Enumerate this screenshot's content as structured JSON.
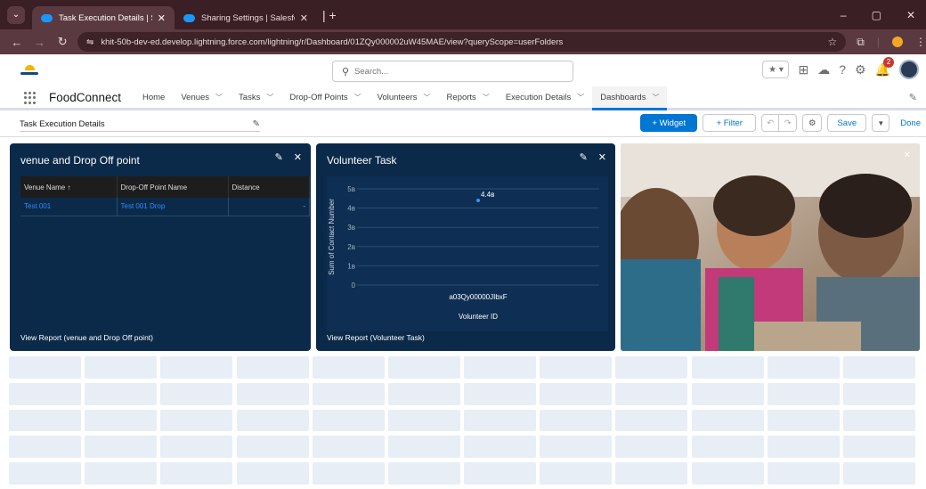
{
  "browser": {
    "tabs": [
      {
        "title": "Task Execution Details | Salesfo",
        "active": true
      },
      {
        "title": "Sharing Settings | Salesforce",
        "active": false
      }
    ],
    "url": "khit-50b-dev-ed.develop.lightning.force.com/lightning/r/Dashboard/01ZQy000002uW45MAE/view?queryScope=userFolders",
    "window_controls": [
      "–",
      "▢",
      "✕"
    ]
  },
  "global_header": {
    "search_placeholder": "Search...",
    "notification_count": "2"
  },
  "app_nav": {
    "app_name": "FoodConnect",
    "items": [
      {
        "label": "Home",
        "has_menu": false
      },
      {
        "label": "Venues",
        "has_menu": true
      },
      {
        "label": "Tasks",
        "has_menu": true
      },
      {
        "label": "Drop-Off Points",
        "has_menu": true
      },
      {
        "label": "Volunteers",
        "has_menu": true
      },
      {
        "label": "Reports",
        "has_menu": true
      },
      {
        "label": "Execution Details",
        "has_menu": true
      },
      {
        "label": "Dashboards",
        "has_menu": true,
        "active": true
      }
    ]
  },
  "toolbar": {
    "dashboard_title": "Task Execution Details",
    "widget_label": "+ Widget",
    "filter_label": "+ Filter",
    "save_label": "Save",
    "done_label": "Done"
  },
  "widgets": {
    "table_widget": {
      "title": "venue and Drop Off point",
      "columns": [
        "Venue Name ↑",
        "Drop-Off Point Name",
        "Distance"
      ],
      "rows": [
        [
          "Test 001",
          "Test 001 Drop",
          "-"
        ]
      ],
      "footer": "View Report (venue and Drop Off point)"
    },
    "chart_widget": {
      "title": "Volunteer Task",
      "footer": "View Report (Volunteer Task)"
    }
  },
  "chart_data": {
    "type": "scatter",
    "title": "Volunteer Task",
    "xlabel": "Volunteer ID",
    "ylabel": "Sum of Contact Number",
    "categories": [
      "a03Qy00000JIbxF"
    ],
    "values": [
      4400000000
    ],
    "data_labels": [
      "4.4в"
    ],
    "ytick_labels": [
      "0",
      "1в",
      "2в",
      "3в",
      "4в",
      "5в"
    ],
    "yticks": [
      0,
      1000000000,
      2000000000,
      3000000000,
      4000000000,
      5000000000
    ],
    "ylim": [
      0,
      5000000000
    ],
    "grid": true,
    "series_color": "#3c91ff"
  },
  "colors": {
    "brand": "#0176d3",
    "widget_bg": "#0a2744",
    "browser_frame": "#3a1f24"
  }
}
